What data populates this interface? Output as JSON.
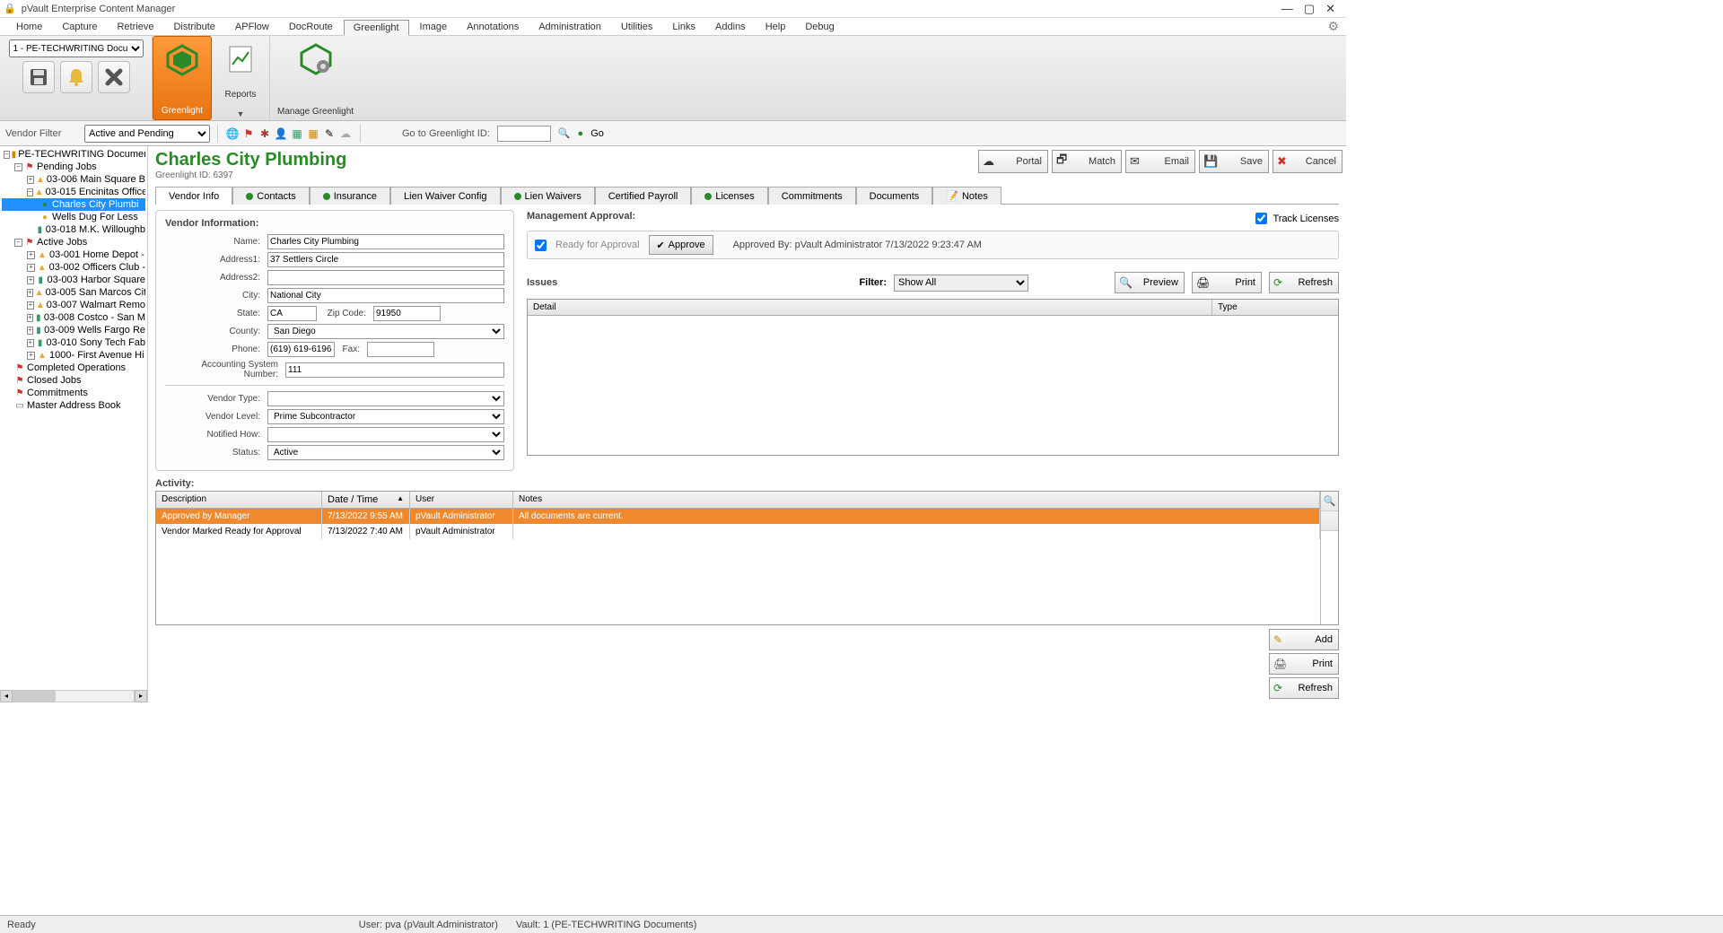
{
  "window": {
    "title": "pVault Enterprise Content Manager"
  },
  "menu": [
    "Home",
    "Capture",
    "Retrieve",
    "Distribute",
    "APFlow",
    "DocRoute",
    "Greenlight",
    "Image",
    "Annotations",
    "Administration",
    "Utilities",
    "Links",
    "Addins",
    "Help",
    "Debug"
  ],
  "menu_active": "Greenlight",
  "ribbon": {
    "doc_selector": "1 - PE-TECHWRITING Documen",
    "groups": [
      {
        "label": "Greenlight",
        "active": true
      },
      {
        "label": "Reports",
        "active": false,
        "dropdown": true
      },
      {
        "label": "Manage Greenlight",
        "active": false
      }
    ]
  },
  "filter_bar": {
    "vendor_filter_label": "Vendor Filter",
    "vendor_filter_value": "Active and Pending",
    "goto_label": "Go to Greenlight ID:",
    "go_label": "Go"
  },
  "tree": {
    "root": "PE-TECHWRITING Documents",
    "pending": "Pending Jobs",
    "pending_jobs": [
      {
        "id": "03-006",
        "name": "Main Square B",
        "exp": true,
        "warn": true
      },
      {
        "id": "03-015",
        "name": "Encinitas Office",
        "exp": true,
        "warn": true,
        "open": true,
        "children": [
          {
            "name": "Charles City Plumbi",
            "selected": true,
            "dot": "green"
          },
          {
            "name": "Wells Dug For Less",
            "dot": "orange"
          }
        ]
      },
      {
        "id": "03-018",
        "name": "M.K. Willoughb",
        "bar": true
      }
    ],
    "active": "Active Jobs",
    "active_jobs": [
      {
        "id": "03-001",
        "name": "Home Depot -",
        "exp": true,
        "warn": true
      },
      {
        "id": "03-002",
        "name": "Officers Club -",
        "exp": true,
        "warn": true
      },
      {
        "id": "03-003",
        "name": "Harbor Square",
        "exp": true,
        "bar": true
      },
      {
        "id": "03-005",
        "name": "San Marcos Cit",
        "exp": true,
        "warn": true
      },
      {
        "id": "03-007",
        "name": "Walmart Remo",
        "exp": true,
        "warn": true
      },
      {
        "id": "03-008",
        "name": "Costco - San M",
        "exp": true,
        "bar": true
      },
      {
        "id": "03-009",
        "name": "Wells Fargo Re",
        "exp": true,
        "bar": true
      },
      {
        "id": "03-010",
        "name": "Sony Tech Fab",
        "exp": true,
        "bar": true
      },
      {
        "id": "1000-",
        "name": "First  Avenue Hi",
        "exp": true,
        "warn": true
      }
    ],
    "sections": [
      "Completed Operations",
      "Closed Jobs",
      "Commitments",
      "Master Address Book"
    ]
  },
  "vendor": {
    "title": "Charles City Plumbing",
    "greenlight_id": "Greenlight ID: 6397"
  },
  "top_buttons": [
    "Portal",
    "Match",
    "Email",
    "Save",
    "Cancel"
  ],
  "tabs": [
    {
      "label": "Vendor Info",
      "active": true
    },
    {
      "label": "Contacts",
      "dot": "green"
    },
    {
      "label": "Insurance",
      "dot": "green"
    },
    {
      "label": "Lien Waiver Config"
    },
    {
      "label": "Lien Waivers",
      "dot": "green"
    },
    {
      "label": "Certified Payroll"
    },
    {
      "label": "Licenses",
      "dot": "green"
    },
    {
      "label": "Commitments"
    },
    {
      "label": "Documents"
    },
    {
      "label": "Notes",
      "icon": "note"
    }
  ],
  "vendor_info": {
    "section": "Vendor Information:",
    "labels": {
      "name": "Name:",
      "addr1": "Address1:",
      "addr2": "Address2:",
      "city": "City:",
      "state": "State:",
      "zip": "Zip Code:",
      "county": "County:",
      "phone": "Phone:",
      "fax": "Fax:",
      "asn": "Accounting System Number:",
      "vtype": "Vendor Type:",
      "vlevel": "Vendor Level:",
      "notified": "Notified How:",
      "status": "Status:"
    },
    "values": {
      "name": "Charles City Plumbing",
      "addr1": "37 Settlers Circle",
      "addr2": "",
      "city": "National City",
      "state": "CA",
      "zip": "91950",
      "county": "San Diego",
      "phone": "(619) 619-6196",
      "fax": "",
      "asn": "111",
      "vtype": "",
      "vlevel": "Prime Subcontractor",
      "notified": "",
      "status": "Active"
    }
  },
  "mgmt": {
    "section": "Management Approval:",
    "ready": "Ready for Approval",
    "approve": "Approve",
    "approved_by": "Approved By: pVault Administrator 7/13/2022 9:23:47 AM",
    "track": "Track Licenses"
  },
  "issues": {
    "title": "Issues",
    "filter_label": "Filter:",
    "filter_value": "Show All",
    "buttons": [
      "Preview",
      "Print",
      "Refresh"
    ],
    "cols": [
      "Detail",
      "Type"
    ]
  },
  "activity": {
    "title": "Activity:",
    "cols": [
      "Description",
      "Date / Time",
      "User",
      "Notes"
    ],
    "rows": [
      {
        "desc": "Approved by Manager",
        "dt": "7/13/2022 9:55 AM",
        "user": "pVault Administrator",
        "notes": "All documents are current.",
        "sel": true
      },
      {
        "desc": "Vendor Marked Ready for Approval",
        "dt": "7/13/2022 7:40 AM",
        "user": "pVault Administrator",
        "notes": ""
      }
    ],
    "right_buttons": [
      "Add",
      "Print",
      "Refresh"
    ]
  },
  "status": {
    "ready": "Ready",
    "user": "User: pva (pVault Administrator)",
    "vault": "Vault: 1 (PE-TECHWRITING Documents)"
  }
}
